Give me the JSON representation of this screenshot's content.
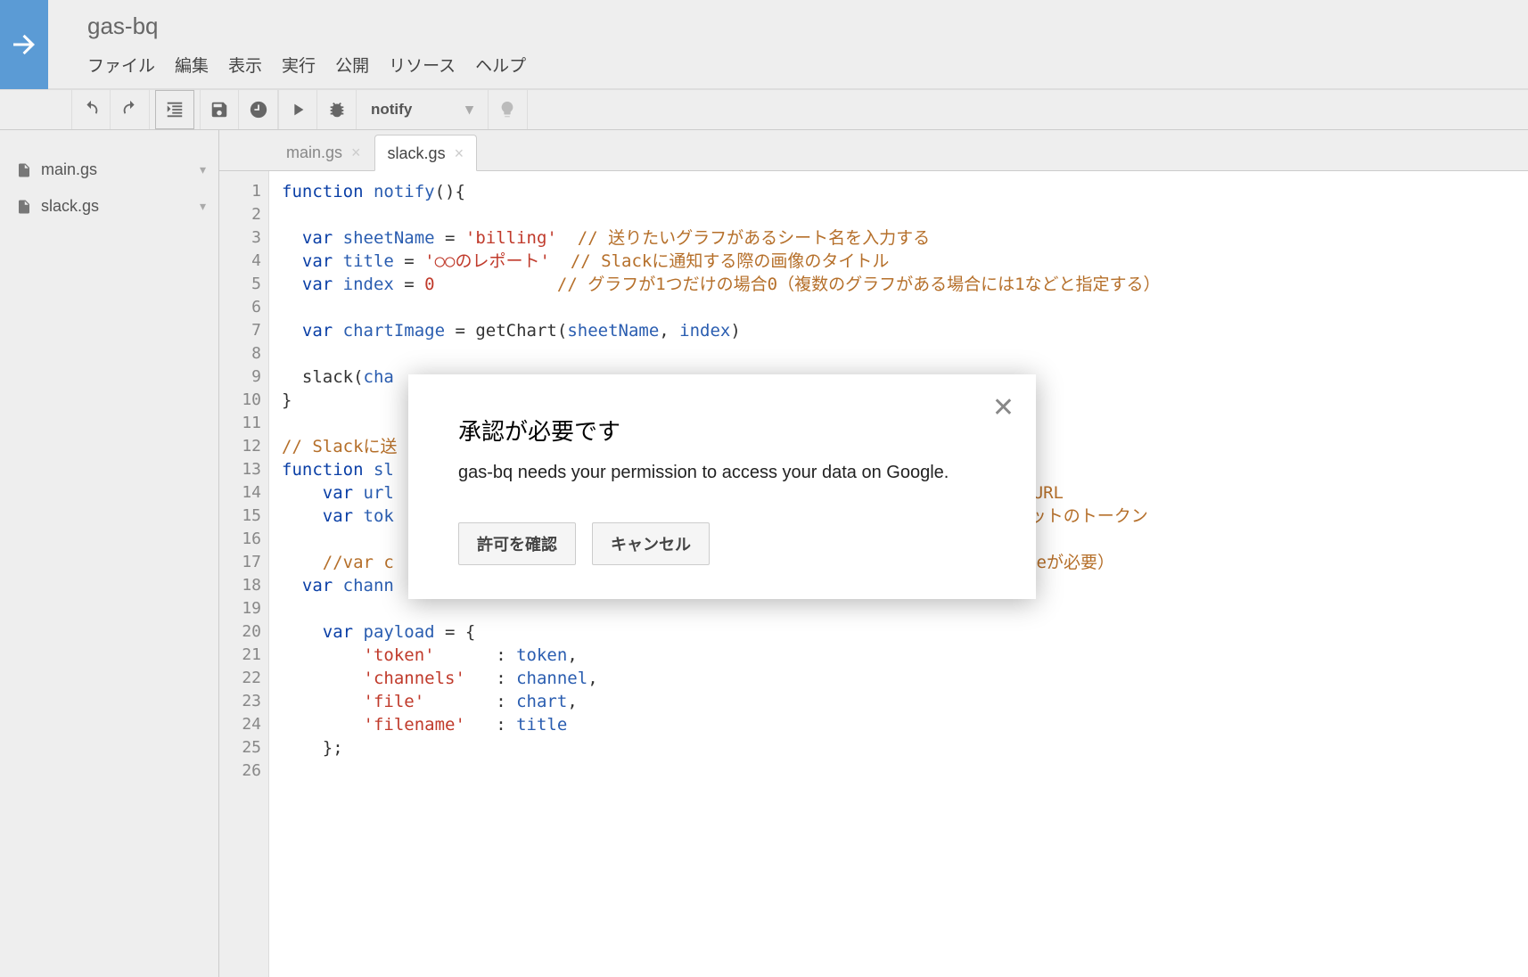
{
  "header": {
    "project_title": "gas-bq",
    "menu": [
      "ファイル",
      "編集",
      "表示",
      "実行",
      "公開",
      "リソース",
      "ヘルプ"
    ]
  },
  "toolbar": {
    "function_select": "notify"
  },
  "sidebar": {
    "files": [
      {
        "name": "main.gs"
      },
      {
        "name": "slack.gs"
      }
    ]
  },
  "tabs": [
    {
      "label": "main.gs",
      "active": false
    },
    {
      "label": "slack.gs",
      "active": true
    }
  ],
  "code": {
    "lines": [
      {
        "n": 1,
        "segs": [
          {
            "t": "function ",
            "c": "kw"
          },
          {
            "t": "notify",
            "c": "ident"
          },
          {
            "t": "(){",
            "c": "pun"
          }
        ]
      },
      {
        "n": 2,
        "segs": []
      },
      {
        "n": 3,
        "segs": [
          {
            "t": "  var ",
            "c": "kw"
          },
          {
            "t": "sheetName",
            "c": "ident"
          },
          {
            "t": " = ",
            "c": "pun"
          },
          {
            "t": "'billing'",
            "c": "str"
          },
          {
            "t": "  ",
            "c": "pun"
          },
          {
            "t": "// 送りたいグラフがあるシート名を入力する",
            "c": "cmt"
          }
        ]
      },
      {
        "n": 4,
        "segs": [
          {
            "t": "  var ",
            "c": "kw"
          },
          {
            "t": "title",
            "c": "ident"
          },
          {
            "t": " = ",
            "c": "pun"
          },
          {
            "t": "'○○のレポート'",
            "c": "str"
          },
          {
            "t": "  ",
            "c": "pun"
          },
          {
            "t": "// Slackに通知する際の画像のタイトル",
            "c": "cmt"
          }
        ]
      },
      {
        "n": 5,
        "segs": [
          {
            "t": "  var ",
            "c": "kw"
          },
          {
            "t": "index",
            "c": "ident"
          },
          {
            "t": " = ",
            "c": "pun"
          },
          {
            "t": "0",
            "c": "num"
          },
          {
            "t": "            ",
            "c": "pun"
          },
          {
            "t": "// グラフが1つだけの場合0（複数のグラフがある場合には1などと指定する）",
            "c": "cmt"
          }
        ]
      },
      {
        "n": 6,
        "segs": []
      },
      {
        "n": 7,
        "segs": [
          {
            "t": "  var ",
            "c": "kw"
          },
          {
            "t": "chartImage",
            "c": "ident"
          },
          {
            "t": " = getChart(",
            "c": "pun"
          },
          {
            "t": "sheetName",
            "c": "ident"
          },
          {
            "t": ", ",
            "c": "pun"
          },
          {
            "t": "index",
            "c": "ident"
          },
          {
            "t": ")",
            "c": "pun"
          }
        ]
      },
      {
        "n": 8,
        "segs": []
      },
      {
        "n": 9,
        "segs": [
          {
            "t": "  slack(",
            "c": "pun"
          },
          {
            "t": "cha",
            "c": "ident"
          }
        ]
      },
      {
        "n": 10,
        "segs": [
          {
            "t": "}",
            "c": "pun"
          }
        ]
      },
      {
        "n": 11,
        "segs": []
      },
      {
        "n": 12,
        "segs": [
          {
            "t": "// Slackに送",
            "c": "cmt"
          }
        ]
      },
      {
        "n": 13,
        "segs": [
          {
            "t": "function ",
            "c": "kw"
          },
          {
            "t": "sl",
            "c": "ident"
          }
        ]
      },
      {
        "n": 14,
        "segs": [
          {
            "t": "    var ",
            "c": "kw"
          },
          {
            "t": "url",
            "c": "ident"
          },
          {
            "t": "                                                             ",
            "c": ""
          },
          {
            "t": "のURL",
            "c": "cmt"
          }
        ]
      },
      {
        "n": 15,
        "segs": [
          {
            "t": "    var ",
            "c": "kw"
          },
          {
            "t": "tok",
            "c": "ident"
          },
          {
            "t": "                                                        ",
            "c": ""
          },
          {
            "t": "ackのボットのトークン",
            "c": "cmt"
          }
        ]
      },
      {
        "n": 16,
        "segs": []
      },
      {
        "n": 17,
        "segs": [
          {
            "t": "    //var c",
            "c": "cmt"
          },
          {
            "t": "                                                              ",
            "c": ""
          },
          {
            "t": "teが必要）",
            "c": "cmt"
          }
        ]
      },
      {
        "n": 18,
        "segs": [
          {
            "t": "  var ",
            "c": "kw"
          },
          {
            "t": "chann",
            "c": "ident"
          }
        ]
      },
      {
        "n": 19,
        "segs": []
      },
      {
        "n": 20,
        "segs": [
          {
            "t": "    var ",
            "c": "kw"
          },
          {
            "t": "payload",
            "c": "ident"
          },
          {
            "t": " = {",
            "c": "pun"
          }
        ]
      },
      {
        "n": 21,
        "segs": [
          {
            "t": "        ",
            "c": "pun"
          },
          {
            "t": "'token'",
            "c": "str"
          },
          {
            "t": "      : ",
            "c": "pun"
          },
          {
            "t": "token",
            "c": "ident"
          },
          {
            "t": ",",
            "c": "pun"
          }
        ]
      },
      {
        "n": 22,
        "segs": [
          {
            "t": "        ",
            "c": "pun"
          },
          {
            "t": "'channels'",
            "c": "str"
          },
          {
            "t": "   : ",
            "c": "pun"
          },
          {
            "t": "channel",
            "c": "ident"
          },
          {
            "t": ",",
            "c": "pun"
          }
        ]
      },
      {
        "n": 23,
        "segs": [
          {
            "t": "        ",
            "c": "pun"
          },
          {
            "t": "'file'",
            "c": "str"
          },
          {
            "t": "       : ",
            "c": "pun"
          },
          {
            "t": "chart",
            "c": "ident"
          },
          {
            "t": ",",
            "c": "pun"
          }
        ]
      },
      {
        "n": 24,
        "segs": [
          {
            "t": "        ",
            "c": "pun"
          },
          {
            "t": "'filename'",
            "c": "str"
          },
          {
            "t": "   : ",
            "c": "pun"
          },
          {
            "t": "title",
            "c": "ident"
          }
        ]
      },
      {
        "n": 25,
        "segs": [
          {
            "t": "    };",
            "c": "pun"
          }
        ]
      },
      {
        "n": 26,
        "segs": []
      }
    ]
  },
  "dialog": {
    "title": "承認が必要です",
    "body": "gas-bq needs your permission to access your data on Google.",
    "confirm": "許可を確認",
    "cancel": "キャンセル"
  }
}
